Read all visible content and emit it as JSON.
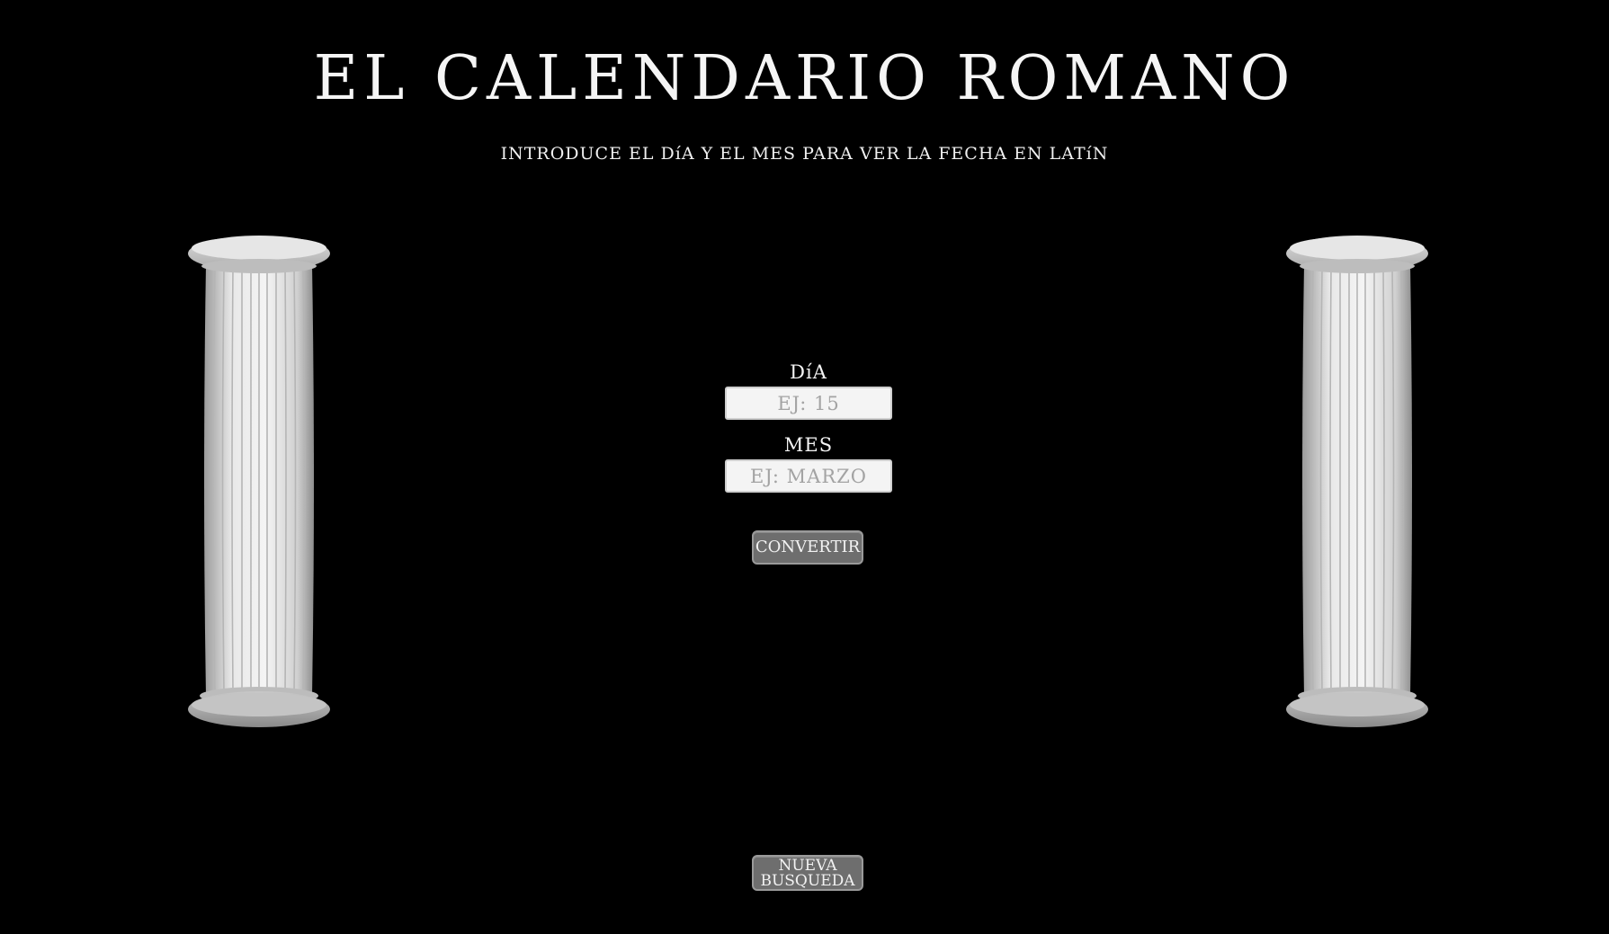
{
  "header": {
    "title": "EL CALENDARIO ROMANO",
    "subtitle": "INTRODUCE EL DíA Y EL MES PARA VER LA FECHA EN LATíN"
  },
  "form": {
    "day_label": "DíA",
    "day_placeholder": "EJ: 15",
    "day_value": "",
    "month_label": "MES",
    "month_placeholder": "EJ: MARZO",
    "month_value": "",
    "convert_label": "CONVERTIR"
  },
  "footer": {
    "new_search_line1": "NUEVA",
    "new_search_line2": "BUSQUEDA"
  },
  "decor": {
    "left_column": "roman-column-icon",
    "right_column": "roman-column-icon"
  },
  "colors": {
    "background": "#000000",
    "text": "#f2f2f2",
    "button": "#6e6e6e",
    "input": "#f4f4f4"
  }
}
